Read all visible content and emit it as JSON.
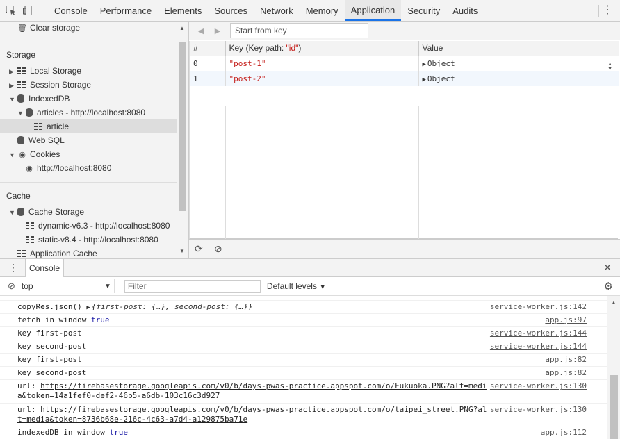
{
  "toolbar": {
    "tabs": [
      "Console",
      "Performance",
      "Elements",
      "Sources",
      "Network",
      "Memory",
      "Application",
      "Security",
      "Audits"
    ],
    "active_tab": "Application",
    "accent_color": "#1a73e8"
  },
  "sidebar": {
    "clear_storage": "Clear storage",
    "storage_heading": "Storage",
    "local_storage": "Local Storage",
    "session_storage": "Session Storage",
    "indexeddb": "IndexedDB",
    "articles_db": "articles - http://localhost:8080",
    "article_store": "article",
    "web_sql": "Web SQL",
    "cookies": "Cookies",
    "cookie_origin": "http://localhost:8080",
    "cache_heading": "Cache",
    "cache_storage": "Cache Storage",
    "cache_dynamic": "dynamic-v6.3 - http://localhost:8080",
    "cache_static": "static-v8.4 - http://localhost:8080",
    "application_cache": "Application Cache"
  },
  "idb_view": {
    "start_key_placeholder": "Start from key",
    "columns": [
      "#",
      "Key (Key path: ",
      "\"id\"",
      ")",
      "Value"
    ],
    "rows": [
      {
        "index": "0",
        "key": "\"post-1\"",
        "value": "Object"
      },
      {
        "index": "1",
        "key": "\"post-2\"",
        "value": "Object"
      }
    ]
  },
  "console": {
    "tab_label": "Console",
    "context": "top",
    "filter_placeholder": "Filter",
    "levels": "Default levels",
    "logs": [
      {
        "pre": "copyRes.json() ",
        "obj": "{first-post: {…}, second-post: {…}}",
        "src": "service-worker.js:142"
      },
      {
        "pre": "fetch in window ",
        "kw": "true",
        "src": "app.js:97"
      },
      {
        "pre": "key first-post",
        "src": "service-worker.js:144"
      },
      {
        "pre": "key second-post",
        "src": "service-worker.js:144"
      },
      {
        "pre": "key first-post",
        "src": "app.js:82"
      },
      {
        "pre": "key second-post",
        "src": "app.js:82"
      },
      {
        "pre": "url: ",
        "url1": "https://firebasestorage.googleapis.com/v0/b/days-pwas-practice.appspot.com/o/Fukuoka.PNG?alt=medi",
        "url2": "a&token=14a1fef0-def2-46b5-a6db-103c16c3d927",
        "src": "service-worker.js:130"
      },
      {
        "pre": "url: ",
        "url1": "https://firebasestorage.googleapis.com/v0/b/days-pwas-practice.appspot.com/o/taipei_street.PNG?al",
        "url2": "t=media&token=8736b68e-216c-4c63-a7d4-a129875ba71e",
        "src": "service-worker.js:130"
      },
      {
        "pre": "indexedDB in window ",
        "kw": "true",
        "src": "app.js:112"
      }
    ]
  }
}
